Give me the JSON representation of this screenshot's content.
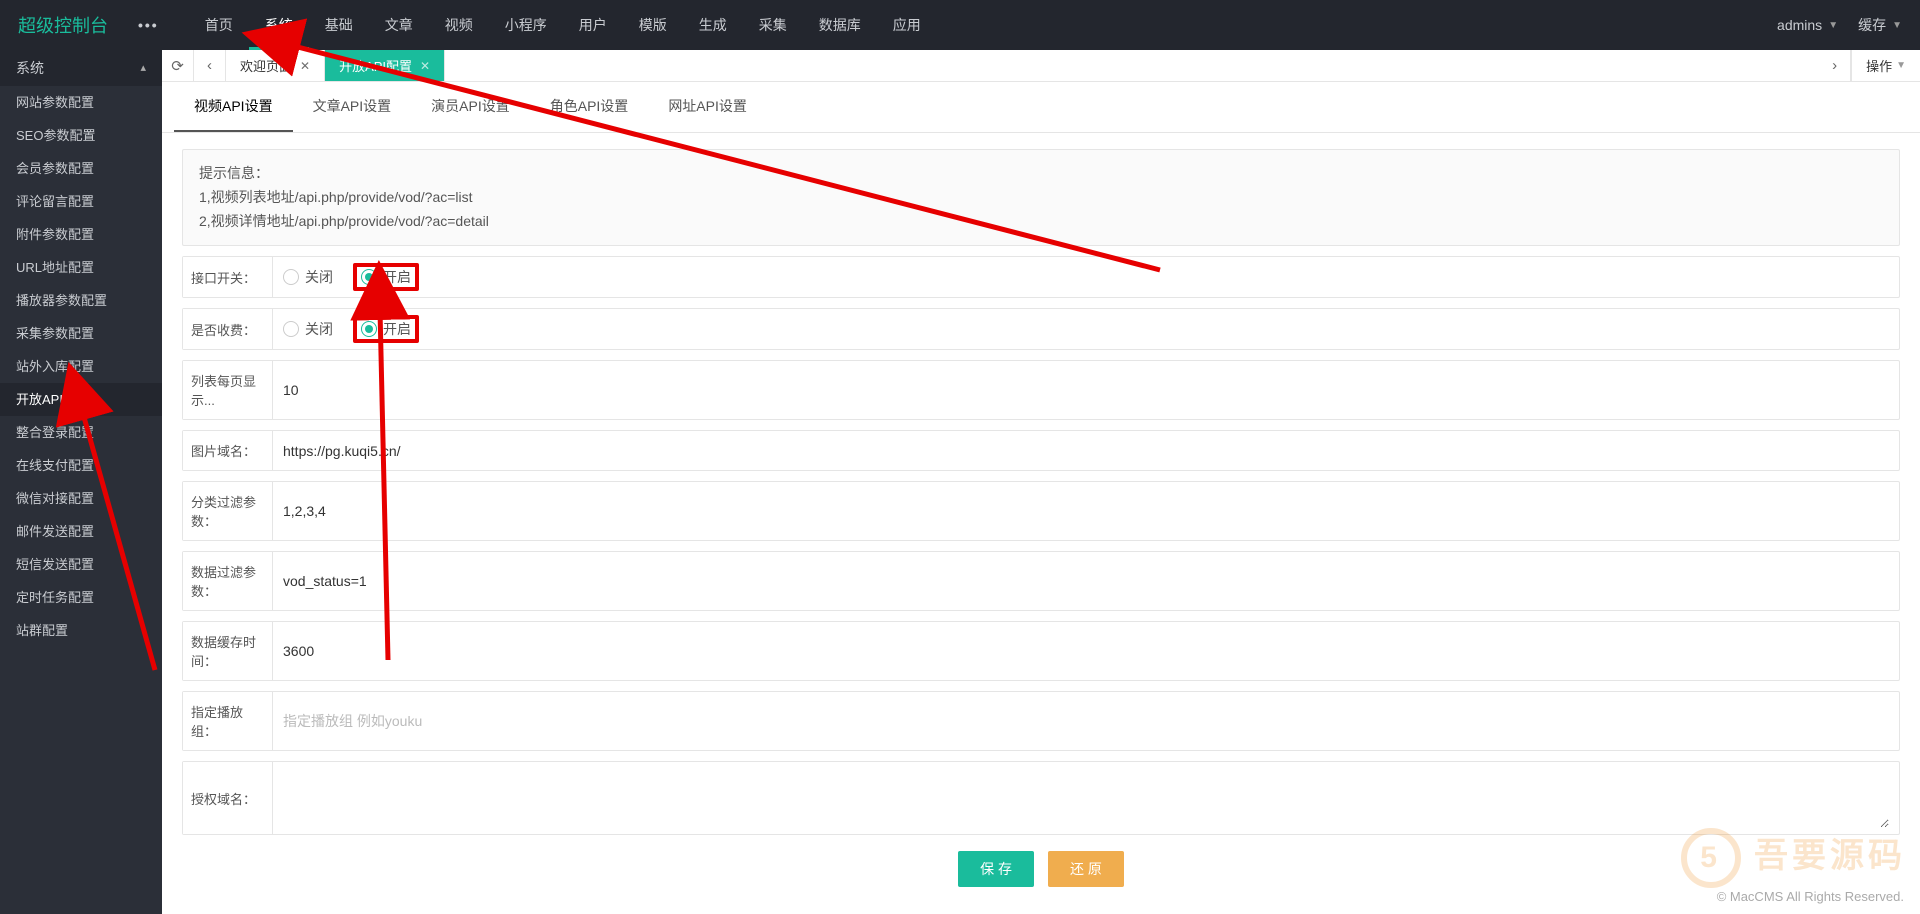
{
  "brand": "超级控制台",
  "topnav": [
    "首页",
    "系统",
    "基础",
    "文章",
    "视频",
    "小程序",
    "用户",
    "模版",
    "生成",
    "采集",
    "数据库",
    "应用"
  ],
  "topnav_active_index": 1,
  "user_menu": "admins",
  "cache_menu": "缓存",
  "sidebar_header": "系统",
  "sidebar_items": [
    "网站参数配置",
    "SEO参数配置",
    "会员参数配置",
    "评论留言配置",
    "附件参数配置",
    "URL地址配置",
    "播放器参数配置",
    "采集参数配置",
    "站外入库配置",
    "开放API配置",
    "整合登录配置",
    "在线支付配置",
    "微信对接配置",
    "邮件发送配置",
    "短信发送配置",
    "定时任务配置",
    "站群配置"
  ],
  "sidebar_active_index": 9,
  "page_tabs": [
    {
      "label": "欢迎页面",
      "active": false
    },
    {
      "label": "开放API配置",
      "active": true
    }
  ],
  "ops_label": "操作",
  "sub_tabs": [
    "视频API设置",
    "文章API设置",
    "演员API设置",
    "角色API设置",
    "网址API设置"
  ],
  "sub_tab_active_index": 0,
  "hint_title": "提示信息：",
  "hint_line1": "1,视频列表地址/api.php/provide/vod/?ac=list",
  "hint_line2": "2,视频详情地址/api.php/provide/vod/?ac=detail",
  "form": {
    "switch_label": "接口开关：",
    "charge_label": "是否收费：",
    "opt_close": "关闭",
    "opt_open": "开启",
    "pagesize_label": "列表每页显示...",
    "pagesize_value": "10",
    "imgdomain_label": "图片域名：",
    "imgdomain_value": "https://pg.kuqi5.cn/",
    "typefilter_label": "分类过滤参数：",
    "typefilter_value": "1,2,3,4",
    "datafilter_label": "数据过滤参数：",
    "datafilter_value": "vod_status=1",
    "cache_label": "数据缓存时间：",
    "cache_value": "3600",
    "playgroup_label": "指定播放组：",
    "playgroup_placeholder": "指定播放组 例如youku",
    "authdomain_label": "授权域名："
  },
  "buttons": {
    "save": "保 存",
    "reset": "还 原"
  },
  "footer": "© MacCMS All Rights Reserved.",
  "watermark": "吾要源码"
}
